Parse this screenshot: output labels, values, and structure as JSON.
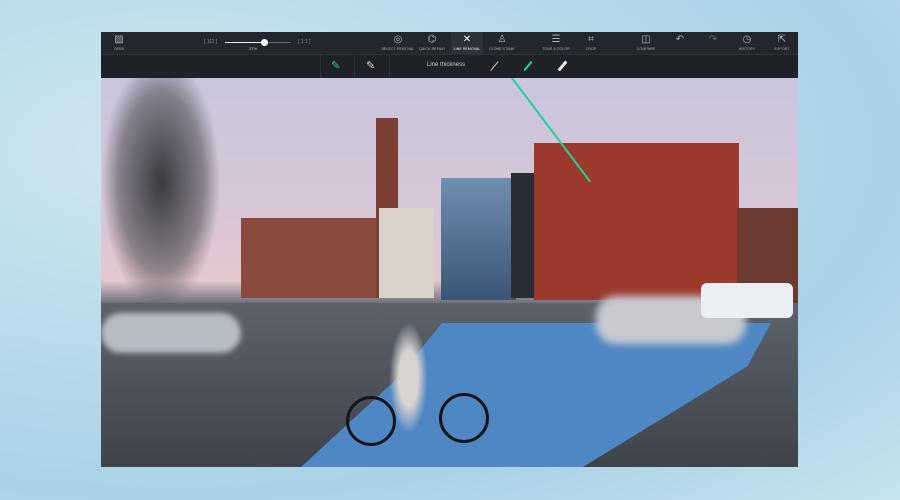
{
  "toolbar": {
    "open": "OPEN",
    "zoom_min": "[ 111 ]",
    "zoom_max": "[ 1:1 ]",
    "zoom_percent": "37%",
    "zoom_value": 0.58,
    "select_removal": "SELECT REMOVAL",
    "quick_repair": "QUICK REPAIR",
    "line_removal": "LINE REMOVAL",
    "clone_stamp": "CLONE STAMP",
    "tone_color": "TONE & COLOR",
    "crop": "CROP",
    "compare": "COMPARE",
    "history": "HISTORY",
    "export": "EXPORT"
  },
  "subbar": {
    "line_thickness": "Line thickness"
  },
  "colors": {
    "accent": "#1ed39a"
  }
}
